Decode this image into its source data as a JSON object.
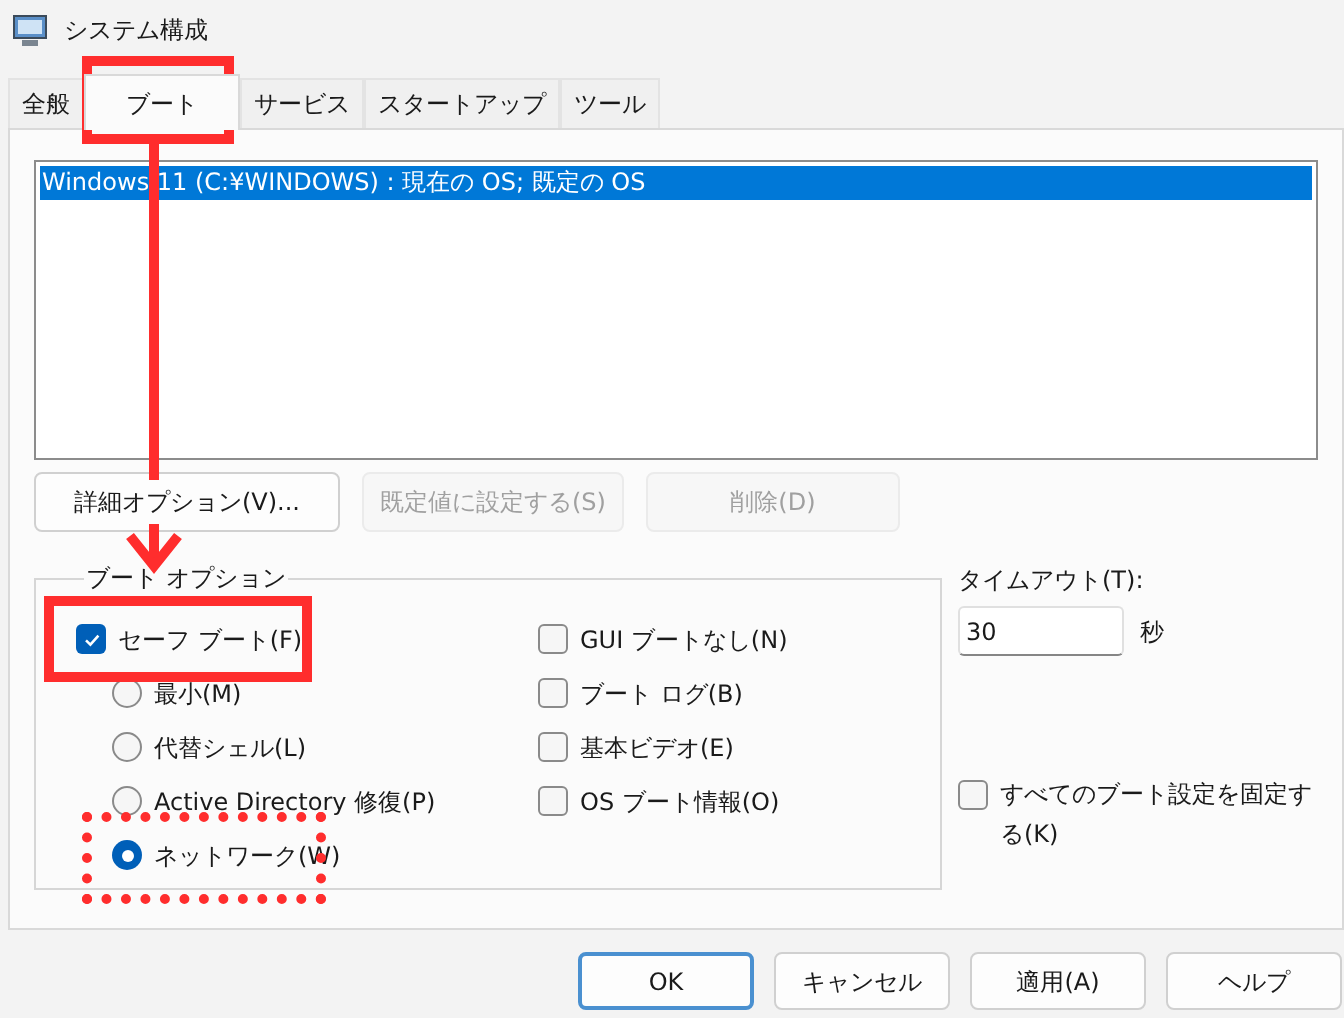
{
  "window": {
    "title": "システム構成"
  },
  "tabs": [
    {
      "label": "全般",
      "selected": false
    },
    {
      "label": "ブート",
      "selected": true
    },
    {
      "label": "サービス",
      "selected": false
    },
    {
      "label": "スタートアップ",
      "selected": false
    },
    {
      "label": "ツール",
      "selected": false
    }
  ],
  "os_list": {
    "items": [
      {
        "label": "Windows 11 (C:¥WINDOWS) : 現在の OS; 既定の OS",
        "selected": true
      }
    ]
  },
  "list_buttons": [
    {
      "label": "詳細オプション(V)...",
      "disabled": false
    },
    {
      "label": "既定値に設定する(S)",
      "disabled": true
    },
    {
      "label": "削除(D)",
      "disabled": true
    }
  ],
  "boot_options": {
    "title": "ブート オプション",
    "safe_boot": {
      "label": "セーフ ブート(F)",
      "checked": true
    },
    "safe_boot_modes": [
      {
        "label": "最小(M)",
        "selected": false
      },
      {
        "label": "代替シェル(L)",
        "selected": false
      },
      {
        "label": "Active Directory 修復(P)",
        "selected": false
      },
      {
        "label": "ネットワーク(W)",
        "selected": true
      }
    ],
    "flags": [
      {
        "label": "GUI ブートなし(N)",
        "checked": false
      },
      {
        "label": "ブート ログ(B)",
        "checked": false
      },
      {
        "label": "基本ビデオ(E)",
        "checked": false
      },
      {
        "label": "OS ブート情報(O)",
        "checked": false
      }
    ]
  },
  "timeout": {
    "label": "タイムアウト(T):",
    "value": "30",
    "unit": "秒"
  },
  "persist": {
    "label": "すべてのブート設定を固定する(K)",
    "checked": false
  },
  "buttons": [
    {
      "label": "OK",
      "default": true
    },
    {
      "label": "キャンセル",
      "default": false
    },
    {
      "label": "適用(A)",
      "default": false
    },
    {
      "label": "ヘルプ",
      "default": false
    }
  ],
  "annotations": [
    {
      "kind": "box"
    },
    {
      "kind": "arrow"
    },
    {
      "kind": "box"
    },
    {
      "kind": "dashed_box"
    }
  ]
}
